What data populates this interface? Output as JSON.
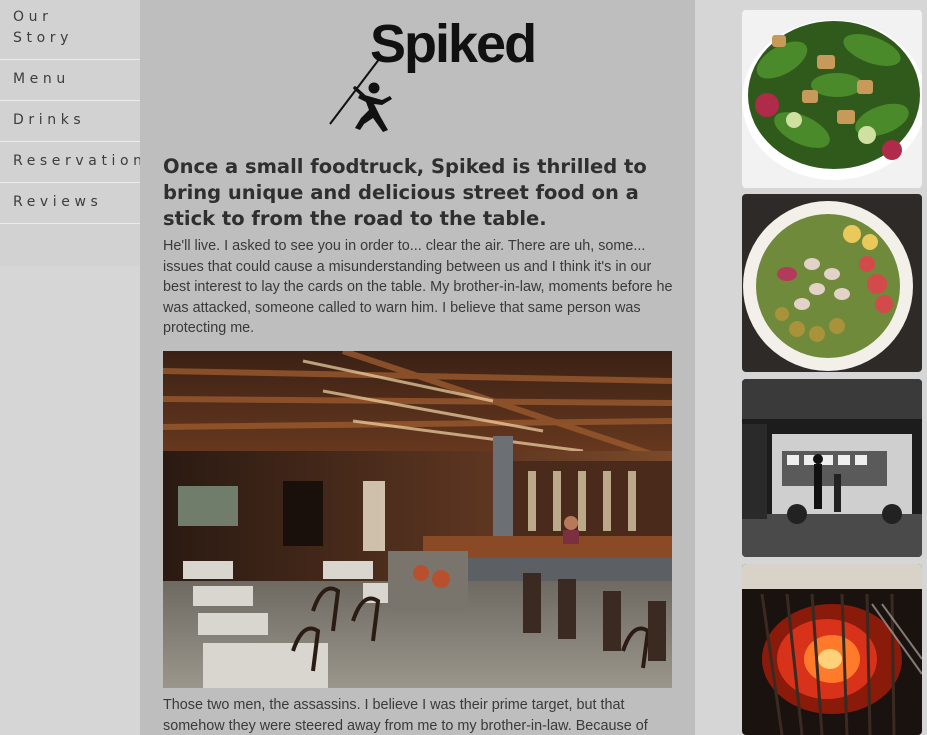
{
  "nav": {
    "items": [
      {
        "label_line1": "Our",
        "label_line2": "Story"
      },
      {
        "label": "Menu"
      },
      {
        "label": "Drinks"
      },
      {
        "label": "Reservations"
      },
      {
        "label": "Reviews"
      }
    ]
  },
  "logo": {
    "text": "Spiked"
  },
  "main": {
    "headline": "Once a small foodtruck, Spiked is thrilled to bring unique and delicious street food on a stick to from the road to the table.",
    "paragraph1": "He'll live. I asked to see you in order to... clear the air. There are uh, some... issues that could cause a misunderstanding between us and I think it's in our best interest to lay the cards on the table. My brother-in-law, moments before he was attacked, someone called to warn him. I believe that same person was protecting me.",
    "paragraph2": "Those two men, the assassins. I believe I was their prime target, but that somehow they were steered away from me to my brother-in-law. Because of"
  },
  "images": {
    "main_photo": "restaurant-interior-photo",
    "side": [
      "green-salad-photo",
      "bean-salad-photo",
      "food-truck-night-photo",
      "grill-fire-photo"
    ]
  },
  "colors": {
    "nav_bg": "#d2d2d2",
    "main_bg": "#bebebe",
    "page_bg": "#d6d6d6",
    "text": "#3a3a3a"
  }
}
